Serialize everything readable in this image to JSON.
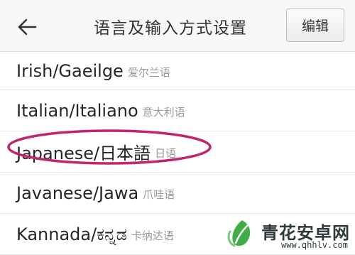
{
  "header": {
    "back_icon": "arrow-left-icon",
    "title": "语言及输入方式设置",
    "edit_label": "编辑"
  },
  "languages": [
    {
      "name": "Irish/Gaeilge",
      "sub": "爱尔兰语"
    },
    {
      "name": "Italian/Italiano",
      "sub": "意大利语"
    },
    {
      "name": "Japanese/日本語",
      "sub": "日语",
      "highlighted": true
    },
    {
      "name": "Javanese/Jawa",
      "sub": "爪哇语"
    },
    {
      "name": "Kannada/ಕನ್ನಡ",
      "sub": "卡纳达语"
    }
  ],
  "highlight_color": "#c2256e",
  "watermark": {
    "logo_icon": "green-leaf-logo-icon",
    "text": "青花安卓网",
    "url": "www.qhhlv.com"
  }
}
